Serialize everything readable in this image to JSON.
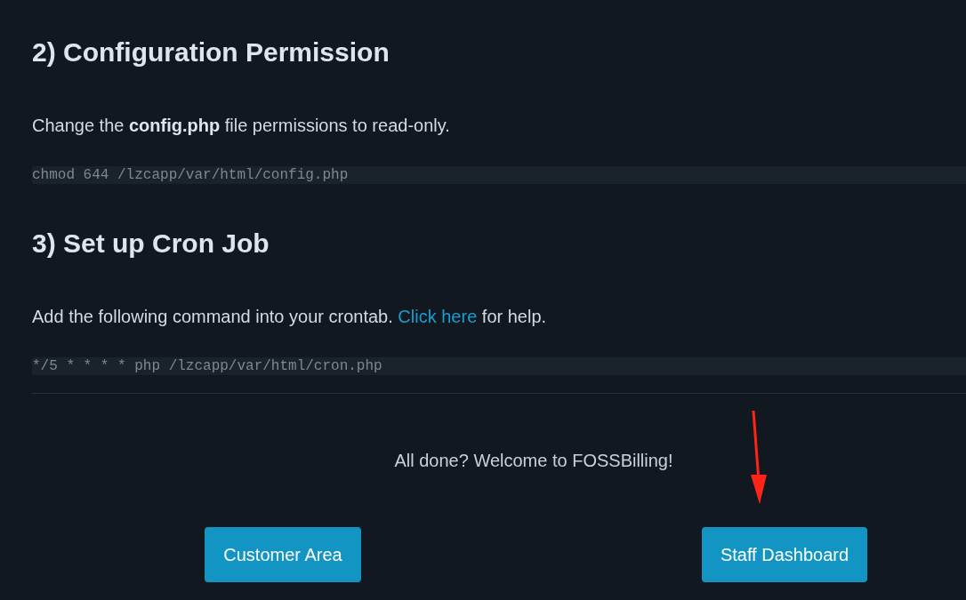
{
  "sections": [
    {
      "heading": "2) Configuration Permission",
      "paragraph": [
        {
          "kind": "text",
          "text": "Change the **config.php** file permissions to read-only."
        }
      ],
      "command": "chmod 644 /lzcapp/var/html/config.php"
    },
    {
      "heading": "3) Set up Cron Job",
      "paragraph": [
        {
          "kind": "text",
          "text": "Add the following command into your crontab. "
        },
        {
          "kind": "link",
          "text": "Click here"
        },
        {
          "kind": "text",
          "text": " for help."
        }
      ],
      "command": "*/5 * * * * php /lzcapp/var/html/cron.php"
    }
  ],
  "welcome": "All done? Welcome to FOSSBilling!",
  "buttons": [
    {
      "label": "Customer Area",
      "annotated": false
    },
    {
      "label": "Staff Dashboard",
      "annotated": true
    }
  ]
}
